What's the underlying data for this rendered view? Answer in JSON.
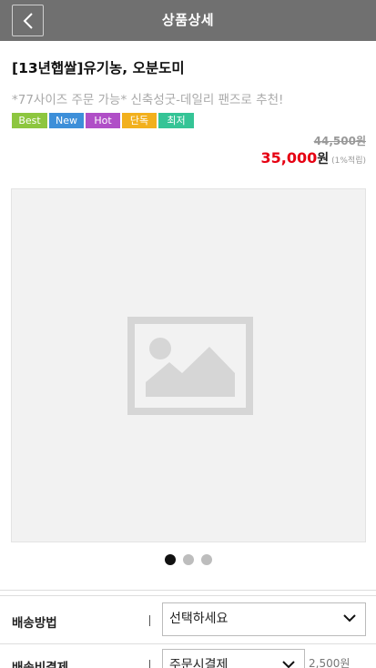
{
  "header": {
    "back_icon": "chevron-left-icon",
    "title": "상품상세"
  },
  "product": {
    "name": "[13년햅쌀]유기농, 오분도미",
    "description": "*77사이즈 주문 가능* 신축성굿-데일리 팬즈로 추천!",
    "badges": [
      {
        "label": "Best",
        "color": "#8dc63f"
      },
      {
        "label": "New",
        "color": "#3d8fd9"
      },
      {
        "label": "Hot",
        "color": "#b04fc7"
      },
      {
        "label": "단독",
        "color": "#f2b01d"
      },
      {
        "label": "최저가",
        "color": "#35c496"
      }
    ],
    "original_price": "44,500원",
    "sale_price": "35,000",
    "currency": "원",
    "points": "(1%적립)",
    "price_color": "#e60012"
  },
  "gallery": {
    "image_icon": "image-placeholder-icon",
    "slide_count": 3,
    "active_slide": 1
  },
  "options": {
    "shipping_method": {
      "label": "배송방법",
      "value": "선택하세요"
    },
    "shipping_payment": {
      "label": "배송비결제",
      "value": "주문시결제",
      "fee": "2,500원"
    }
  }
}
